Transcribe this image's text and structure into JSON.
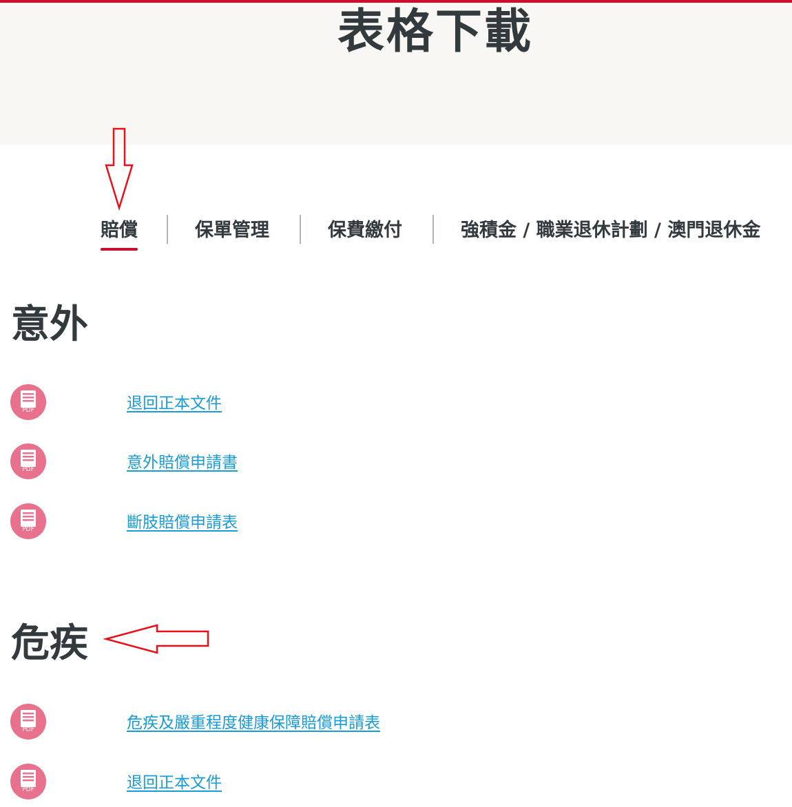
{
  "page": {
    "title": "表格下載"
  },
  "tabs": [
    {
      "label": "賠償",
      "active": true
    },
    {
      "label": "保單管理",
      "active": false
    },
    {
      "label": "保費繳付",
      "active": false
    },
    {
      "label": "強積金 / 職業退休計劃 / 澳門退休金",
      "active": false
    }
  ],
  "sections": [
    {
      "title": "意外",
      "items": [
        {
          "label": "退回正本文件",
          "icon": "pdf-icon"
        },
        {
          "label": "意外賠償申請書",
          "icon": "pdf-icon"
        },
        {
          "label": "斷肢賠償申請表",
          "icon": "pdf-icon"
        }
      ]
    },
    {
      "title": "危疾",
      "items": [
        {
          "label": "危疾及嚴重程度健康保障賠償申請表",
          "icon": "pdf-icon"
        },
        {
          "label": "退回正本文件",
          "icon": "pdf-icon"
        }
      ]
    }
  ],
  "pdf_icon_text": "PDF",
  "colors": {
    "accent": "#c8102e",
    "link": "#1a9bd7",
    "pdf_icon_bg": "#e8728e",
    "hero_bg": "#f9f7f3",
    "annotation_arrow": "#e8101a"
  }
}
